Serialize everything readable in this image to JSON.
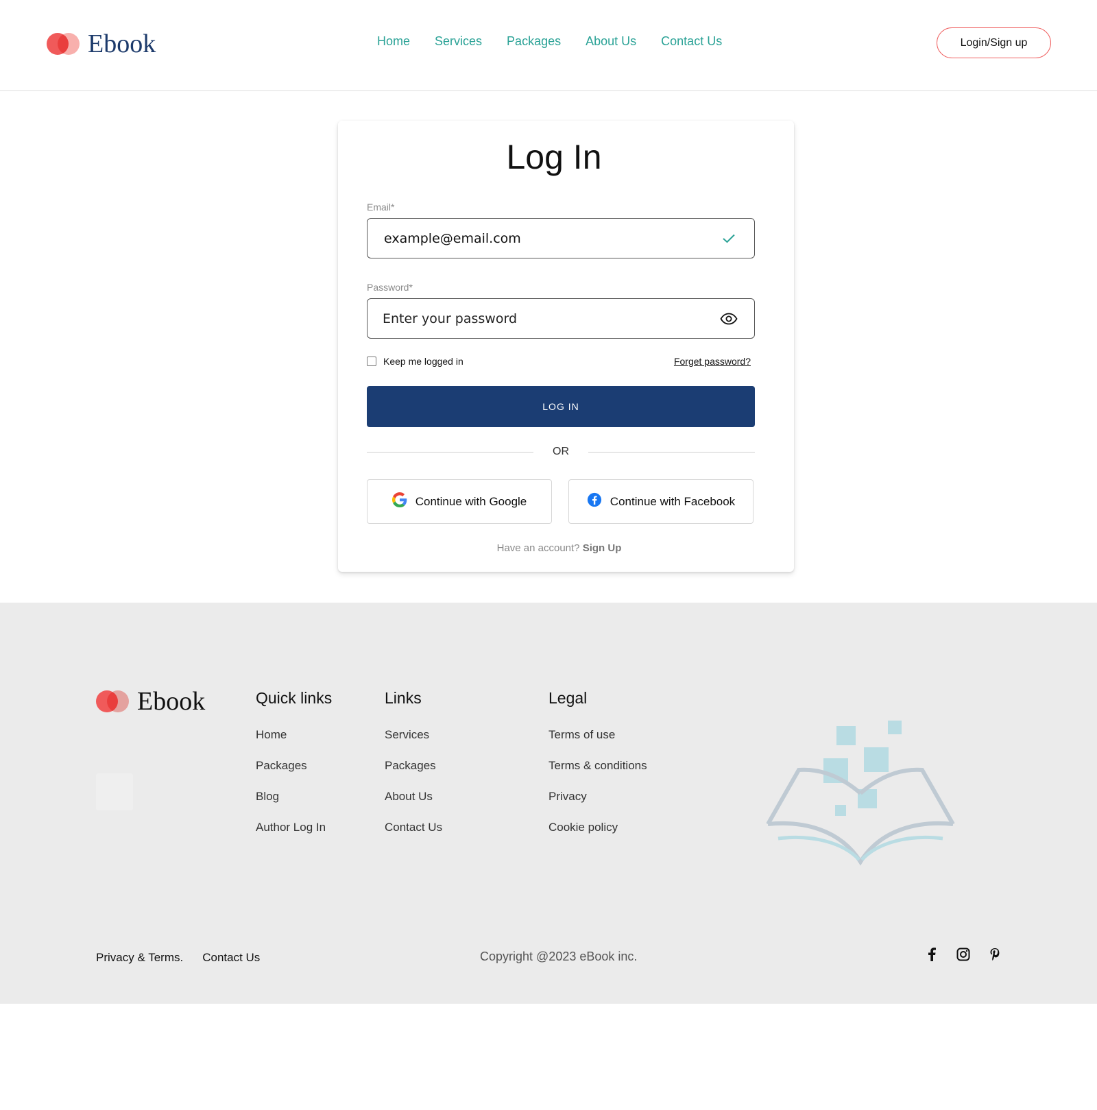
{
  "header": {
    "logo_text": "Ebook",
    "nav": [
      "Home",
      "Services",
      "Packages",
      "About Us",
      "Contact Us"
    ],
    "login_signup": "Login/Sign up"
  },
  "login": {
    "title": "Log In",
    "email_label": "Email*",
    "email_value": "example@email.com",
    "password_label": "Password*",
    "password_placeholder": "Enter your password",
    "keep_logged_in": "Keep me logged in",
    "forgot_password": "Forget password?",
    "login_button": "LOG IN",
    "or": "OR",
    "google_button": "Continue with Google",
    "facebook_button": "Continue with Facebook",
    "have_account": "Have an account?",
    "sign_up": "Sign Up"
  },
  "footer": {
    "logo_text": "Ebook",
    "quick_links": {
      "title": "Quick links",
      "items": [
        "Home",
        "Packages",
        "Blog",
        "Author Log In"
      ]
    },
    "links": {
      "title": "Links",
      "items": [
        "Services",
        "Packages",
        "About Us",
        "Contact Us"
      ]
    },
    "legal": {
      "title": "Legal",
      "items": [
        "Terms of use",
        "Terms & conditions",
        "Privacy",
        "Cookie policy"
      ]
    },
    "bottom_links": [
      "Privacy & Terms.",
      "Contact Us"
    ],
    "copyright": "Copyright @2023 eBook inc.",
    "social_icons": [
      "facebook-icon",
      "instagram-icon",
      "pinterest-icon"
    ]
  },
  "colors": {
    "accent_teal": "#2aa296",
    "primary_navy": "#1b3d73",
    "brand_red": "#f05a5a",
    "footer_bg": "#ebebeb"
  }
}
